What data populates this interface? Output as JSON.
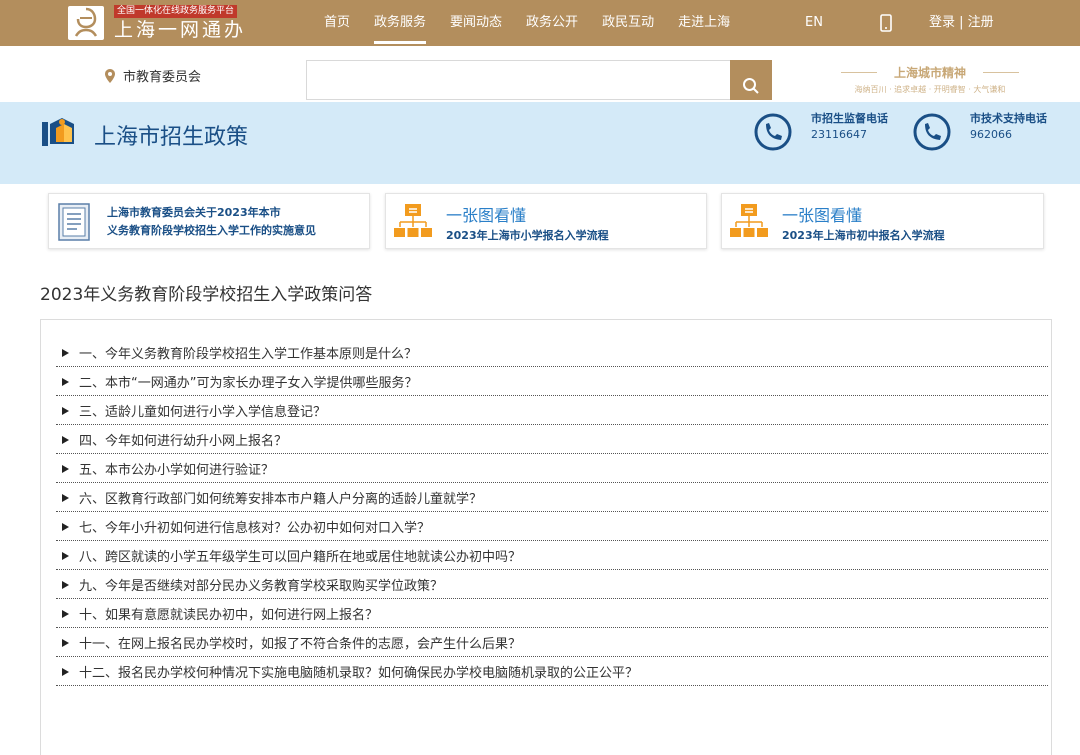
{
  "header": {
    "logo_tag": "全国一体化在线政务服务平台",
    "logo_name": "上海一网通办",
    "nav": [
      {
        "label": "首页",
        "active": false
      },
      {
        "label": "政务服务",
        "active": true
      },
      {
        "label": "要闻动态",
        "active": false
      },
      {
        "label": "政务公开",
        "active": false
      },
      {
        "label": "政民互动",
        "active": false
      },
      {
        "label": "走进上海",
        "active": false
      }
    ],
    "lang": "EN",
    "login": "登录 | 注册",
    "bg_color": "#b38e5d"
  },
  "search": {
    "location": "市教育委员会",
    "value": "",
    "placeholder": ""
  },
  "slogan": {
    "title": "上海城市精神",
    "sub": "海纳百川 · 追求卓越 · 开明睿智 · 大气谦和"
  },
  "banner": {
    "title": "上海市招生政策",
    "hotlines": [
      {
        "label": "市招生监督电话",
        "number": "23116647"
      },
      {
        "label": "市技术支持电话",
        "number": "962066"
      }
    ]
  },
  "cards": [
    {
      "line1": "上海市教育委员会关于2023年本市",
      "line2": "义务教育阶段学校招生入学工作的实施意见"
    },
    {
      "title": "一张图看懂",
      "sub": "2023年上海市小学报名入学流程"
    },
    {
      "title": "一张图看懂",
      "sub": "2023年上海市初中报名入学流程"
    }
  ],
  "section_title": "2023年义务教育阶段学校招生入学政策问答",
  "faq": [
    "一、今年义务教育阶段学校招生入学工作基本原则是什么？",
    "二、本市“一网通办”可为家长办理子女入学提供哪些服务？",
    "三、适龄儿童如何进行小学入学信息登记？",
    "四、今年如何进行幼升小网上报名？",
    "五、本市公办小学如何进行验证？",
    "六、区教育行政部门如何统筹安排本市户籍人户分离的适龄儿童就学？",
    "七、今年小升初如何进行信息核对？公办初中如何对口入学？",
    "八、跨区就读的小学五年级学生可以回户籍所在地或居住地就读公办初中吗？",
    "九、今年是否继续对部分民办义务教育学校采取购买学位政策？",
    "十、如果有意愿就读民办初中，如何进行网上报名？",
    "十一、在网上报名民办学校时，如报了不符合条件的志愿，会产生什么后果？",
    "十二、报名民办学校何种情况下实施电脑随机录取？如何确保民办学校电脑随机录取的公正公平？"
  ]
}
